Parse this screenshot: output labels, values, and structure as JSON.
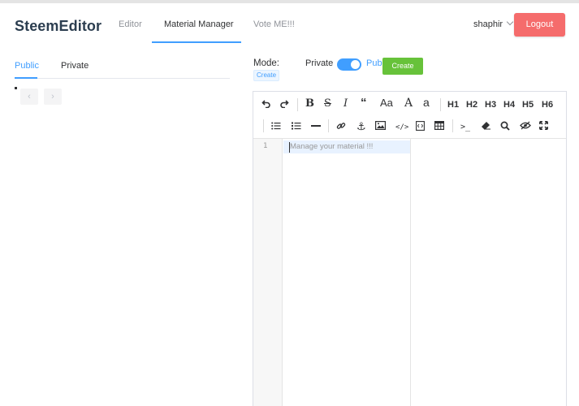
{
  "header": {
    "brand": "SteemEditor",
    "nav": [
      "Editor",
      "Material Manager",
      "Vote ME!!!"
    ],
    "active_nav": "Material Manager",
    "user": "shaphir",
    "logout_label": "Logout"
  },
  "left": {
    "tabs": [
      "Public",
      "Private"
    ],
    "active_tab": "Public",
    "prev": "‹",
    "next": "›"
  },
  "mode": {
    "label": "Mode:",
    "create_tag": "Create",
    "private_label": "Private",
    "public_label": "Publi",
    "switch_on": true,
    "create_button": "Create"
  },
  "editor": {
    "line_number": "1",
    "placeholder": "Manage your material !!!",
    "toolbar_row1": [
      "undo",
      "redo",
      "bold",
      "strikethrough",
      "italic",
      "quote",
      "font-size",
      "font-a",
      "font-a-alt",
      "H1",
      "H2",
      "H3",
      "H4",
      "H5",
      "H6"
    ],
    "toolbar_row2": [
      "unordered-list",
      "ordered-list",
      "horizontal-rule",
      "link",
      "anchor",
      "image",
      "code",
      "code-block",
      "table",
      "terminal",
      "eraser",
      "search",
      "preview",
      "fullscreen"
    ],
    "headings": [
      "H1",
      "H2",
      "H3",
      "H4",
      "H5",
      "H6"
    ]
  },
  "colors": {
    "accent": "#409eff",
    "logout": "#f56c6c",
    "create": "#67c23a"
  }
}
